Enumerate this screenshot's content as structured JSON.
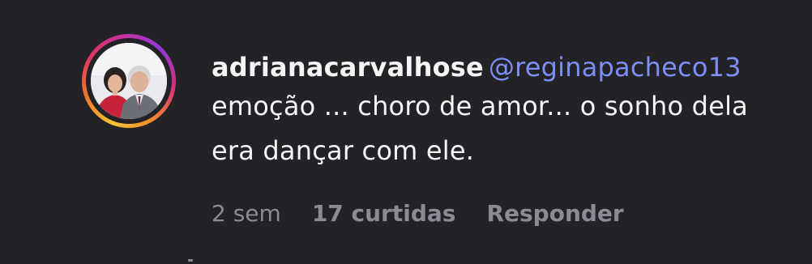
{
  "comment": {
    "username": "adrianacarvalhose",
    "mention": "@reginapacheco13",
    "text": "emoção ... choro de amor... o sonho dela era dançar com ele.",
    "time": "2 sem",
    "likes": "17 curtidas",
    "reply_label": "Responder",
    "avatar_icon": "profile-photo"
  },
  "colors": {
    "background": "#222227",
    "text": "#f5f5f6",
    "mention": "#7d8ff5",
    "meta": "#8b8c93"
  }
}
